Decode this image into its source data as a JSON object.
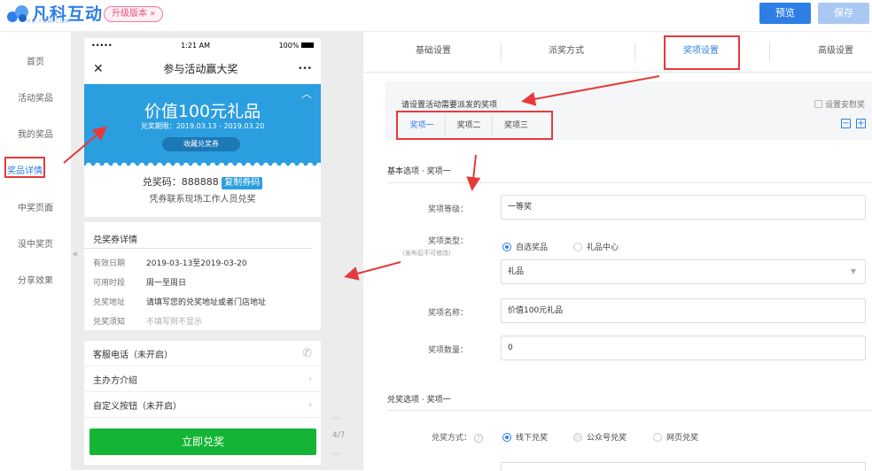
{
  "header": {
    "logo_text": "凡科互动",
    "logo_sub": "HD.FKW.COM",
    "upgrade_label": "升级版本 »",
    "preview_label": "预览",
    "save_label": "保存"
  },
  "sidebar": {
    "items": [
      {
        "label": "首页"
      },
      {
        "label": "活动奖品"
      },
      {
        "label": "我的奖品"
      },
      {
        "label": "奖品详情"
      },
      {
        "label": "中奖页面"
      },
      {
        "label": "没中奖页"
      },
      {
        "label": "分享效果"
      }
    ],
    "active_index": 3,
    "collapse_label": "«"
  },
  "phone": {
    "status_left": "•••••",
    "status_time": "1:21 AM",
    "status_battery": "100%",
    "title": "参与活动赢大奖",
    "close_glyph": "✕",
    "more_glyph": "•••",
    "ticket_value": "价值100元礼品",
    "ticket_period": "兑奖期限：2019.03.13 - 2019.03.20",
    "collect_label": "收藏兑奖券",
    "code_label": "兑奖码：888888",
    "copy_label": "复制券码",
    "code_tip": "凭券联系现场工作人员兑奖",
    "detail_title": "兑奖券详情",
    "details": [
      {
        "key": "有效日期",
        "value": "2019-03-13至2019-03-20"
      },
      {
        "key": "可用时段",
        "value": "周一至周日"
      },
      {
        "key": "兑奖地址",
        "value": "请填写您的兑奖地址或者门店地址"
      },
      {
        "key": "兑奖须知",
        "value": "不填写则不显示"
      }
    ],
    "links": [
      {
        "label": "客服电话（未开启）",
        "icon": "phone-icon"
      },
      {
        "label": "主办方介绍",
        "icon": "chevron-right-icon"
      },
      {
        "label": "自定义按钮（未开启）",
        "icon": "chevron-right-icon"
      }
    ],
    "redeem_label": "立即兑奖",
    "page_indicator": "4/7"
  },
  "tabs": [
    {
      "label": "基础设置"
    },
    {
      "label": "派奖方式"
    },
    {
      "label": "奖项设置"
    },
    {
      "label": "高级设置"
    }
  ],
  "active_tab": 2,
  "prize_panel": {
    "title": "请设置活动需要派发的奖项",
    "consolation_label": "设置安慰奖",
    "sub_tabs": [
      "奖项一",
      "奖项二",
      "奖项三"
    ],
    "minus_label": "−",
    "plus_label": "+"
  },
  "basic_section": {
    "title": "基本选项 · 奖项一",
    "level_label": "奖项等级：",
    "level_value": "一等奖",
    "type_label": "奖项类型：",
    "type_note": "（发布后不可修改）",
    "type_options": [
      "自选奖品",
      "礼品中心"
    ],
    "type_selected": "自选奖品",
    "type_select_value": "礼品",
    "name_label": "奖项名称：",
    "name_value": "价值100元礼品",
    "count_label": "奖项数量：",
    "count_value": "0"
  },
  "redeem_section": {
    "title": "兑奖选项 · 奖项一",
    "method_label": "兑奖方式：",
    "method_options": [
      "线下兑奖",
      "公众号兑奖",
      "网页兑奖"
    ],
    "method_selected": "线下兑奖"
  },
  "colors": {
    "accent": "#2d7fe6",
    "ticket_blue": "#2b9ee0",
    "redeem_green": "#14b535",
    "annotation_red": "#e63a3a"
  }
}
